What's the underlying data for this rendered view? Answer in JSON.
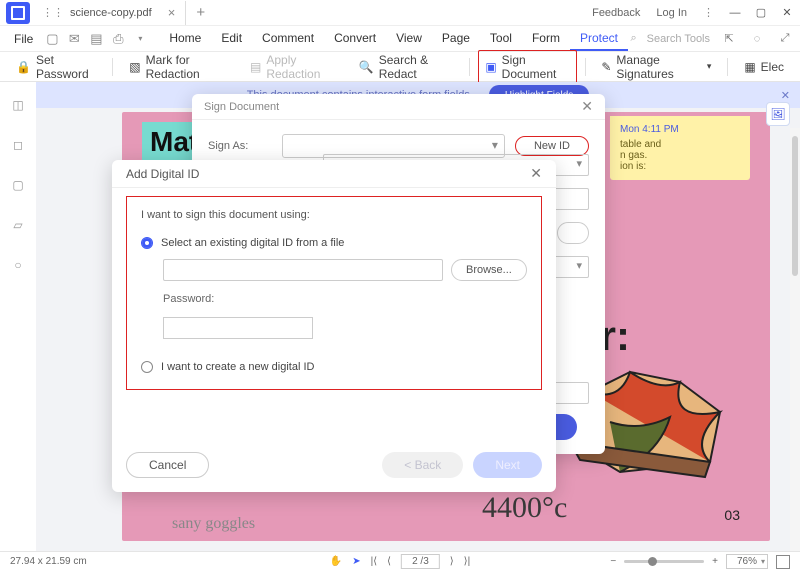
{
  "titlebar": {
    "tab_name": "science-copy.pdf",
    "feedback": "Feedback",
    "login": "Log In"
  },
  "menubar": {
    "file": "File",
    "tabs": [
      "Home",
      "Edit",
      "Comment",
      "Convert",
      "View",
      "Page",
      "Tool",
      "Form",
      "Protect"
    ],
    "active_index": 8,
    "search_placeholder": "Search Tools"
  },
  "toolbar": {
    "set_password": "Set Password",
    "mark_redaction": "Mark for Redaction",
    "apply_redaction": "Apply Redaction",
    "search_redact": "Search & Redact",
    "sign_document": "Sign Document",
    "manage_sigs": "Manage Signatures",
    "elec": "Elec"
  },
  "infobar": {
    "msg": "This document contains interactive form fields.",
    "highlight_btn": "Highlight Fields"
  },
  "doc": {
    "mat": "Mat",
    "sticky_time": "Mon 4:11 PM",
    "sticky_l1": "table and",
    "sticky_l2": "n gas.",
    "sticky_l3": "ion is:",
    "er": "er:",
    "temp": "4400°c",
    "pnum": "03",
    "goggles": "sany goggles"
  },
  "sign_dialog": {
    "title": "Sign Document",
    "sign_as": "Sign As:",
    "new_id": "New ID",
    "sign": "gn"
  },
  "add_dialog": {
    "title": "Add Digital ID",
    "prompt": "I want to sign this document using:",
    "opt1": "Select an existing digital ID from a file",
    "browse": "Browse...",
    "password": "Password:",
    "opt2": "I want to create a new digital ID",
    "cancel": "Cancel",
    "back": "< Back",
    "next": "Next"
  },
  "statusbar": {
    "dims": "27.94 x 21.59 cm",
    "page": "2 /3",
    "zoom": "76%"
  }
}
